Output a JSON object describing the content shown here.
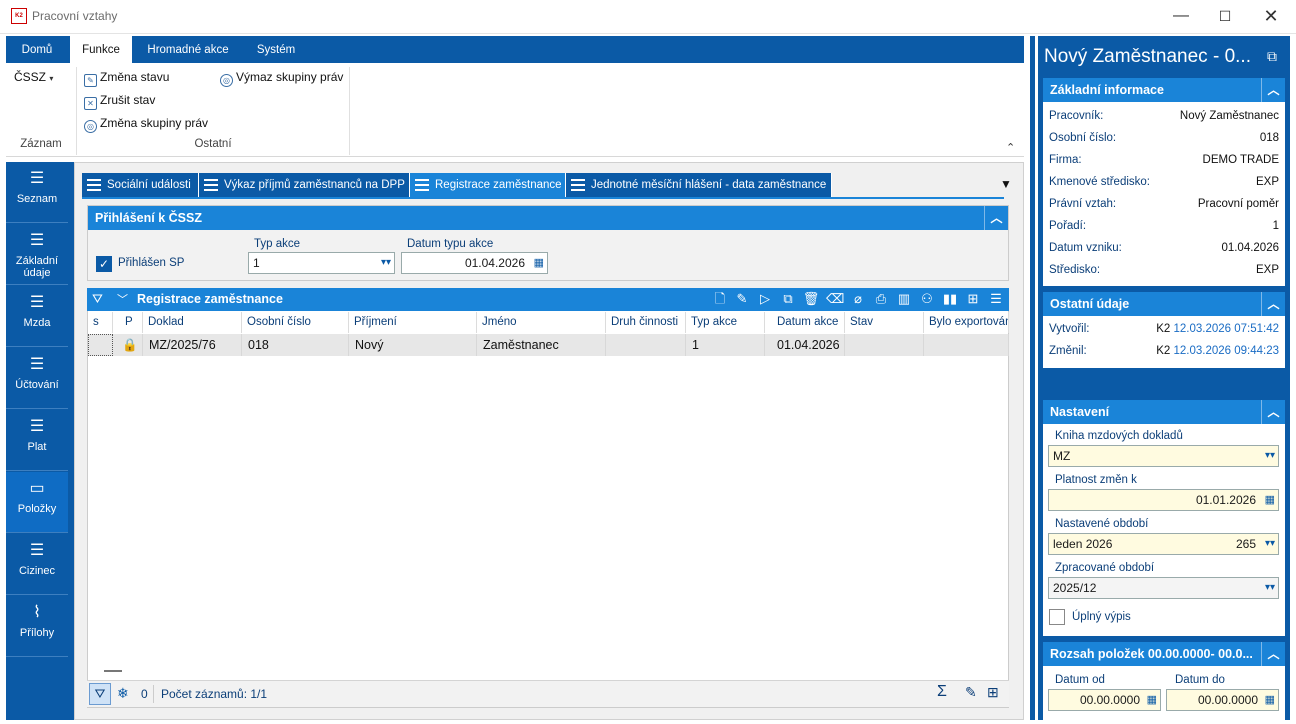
{
  "window": {
    "title": "Pracovní vztahy",
    "logo_text": "K2"
  },
  "ribbon": {
    "tabs": [
      "Domů",
      "Funkce",
      "Hromadné akce",
      "Systém"
    ],
    "cssz_label": "ČSSZ",
    "zmena_stavu": "Změna stavu",
    "zrusit_stav": "Zrušit stav",
    "zmena_skupiny": "Změna skupiny práv",
    "vymaz_skupiny": "Výmaz skupiny práv",
    "group_zaznam": "Záznam",
    "group_ostatni": "Ostatní"
  },
  "nav": [
    {
      "label1": "Seznam",
      "label2": "",
      "icon": "list-icon"
    },
    {
      "label1": "Základní",
      "label2": "údaje",
      "icon": "list-icon"
    },
    {
      "label1": "Mzda",
      "label2": "",
      "icon": "list-icon"
    },
    {
      "label1": "Účtování",
      "label2": "",
      "icon": "list-icon"
    },
    {
      "label1": "Plat",
      "label2": "",
      "icon": "list-icon"
    },
    {
      "label1": "Položky",
      "label2": "",
      "icon": "box-icon"
    },
    {
      "label1": "Cizinec",
      "label2": "",
      "icon": "list-icon"
    },
    {
      "label1": "Přílohy",
      "label2": "",
      "icon": "paperclip-icon"
    }
  ],
  "tabs": [
    "Sociální události",
    "Výkaz příjmů zaměstnanců na DPP",
    "Registrace zaměstnance",
    "Jednotné měsíční hlášení - data zaměstnance"
  ],
  "prihlaseni": {
    "title": "Přihlášení k ČSSZ",
    "prihlasen_label": "Přihlášen SP",
    "typ_akce_label": "Typ akce",
    "typ_akce_value": "1",
    "datum_label": "Datum typu akce",
    "datum_value": "01.04.2026"
  },
  "grid": {
    "title": "Registrace zaměstnance",
    "columns": [
      "s",
      "P",
      "Doklad",
      "Osobní číslo",
      "Příjmení",
      "Jméno",
      "Druh činnosti",
      "Typ akce",
      "Datum akce",
      "Stav",
      "Bylo exportováno"
    ],
    "row": [
      "",
      "",
      "MZ/2025/76",
      "018",
      "Nový",
      "Zaměstnanec",
      "",
      "1",
      "01.04.2026",
      "",
      ""
    ],
    "footer_count_zero": "0",
    "footer_records": "Počet záznamů: 1/1"
  },
  "right": {
    "title": "Nový Zaměstnanec - 0...",
    "zakladni_title": "Základní informace",
    "zakladni": [
      {
        "k": "Pracovník:",
        "v": "Nový Zaměstnanec"
      },
      {
        "k": "Osobní číslo:",
        "v": "018"
      },
      {
        "k": "Firma:",
        "v": "DEMO TRADE"
      },
      {
        "k": "Kmenové středisko:",
        "v": "EXP"
      },
      {
        "k": "Právní vztah:",
        "v": "Pracovní poměr"
      },
      {
        "k": "Pořadí:",
        "v": "1"
      },
      {
        "k": "Datum vzniku:",
        "v": "01.04.2026"
      },
      {
        "k": "Středisko:",
        "v": "EXP"
      }
    ],
    "ostatni_title": "Ostatní údaje",
    "vytvoril_label": "Vytvořil:",
    "vytvoril_user": "K2",
    "vytvoril_date": "12.03.2026 07:51:42",
    "zmenil_label": "Změnil:",
    "zmenil_user": "K2",
    "zmenil_date": "12.03.2026 09:44:23",
    "nastaveni_title": "Nastavení",
    "kniha_label": "Kniha mzdových dokladů",
    "kniha_value": "MZ",
    "platnost_label": "Platnost změn k",
    "platnost_value": "01.01.2026",
    "nastavene_label": "Nastavené období",
    "nastavene_value": "leden 2026",
    "nastavene_num": "265",
    "zpracovane_label": "Zpracované období",
    "zpracovane_value": "2025/12",
    "uplny_label": "Úplný výpis",
    "rozsah_title": "Rozsah položek 00.00.0000- 00.0...",
    "datum_od_label": "Datum od",
    "datum_od_value": "00.00.0000",
    "datum_do_label": "Datum do",
    "datum_do_value": "00.00.0000"
  }
}
